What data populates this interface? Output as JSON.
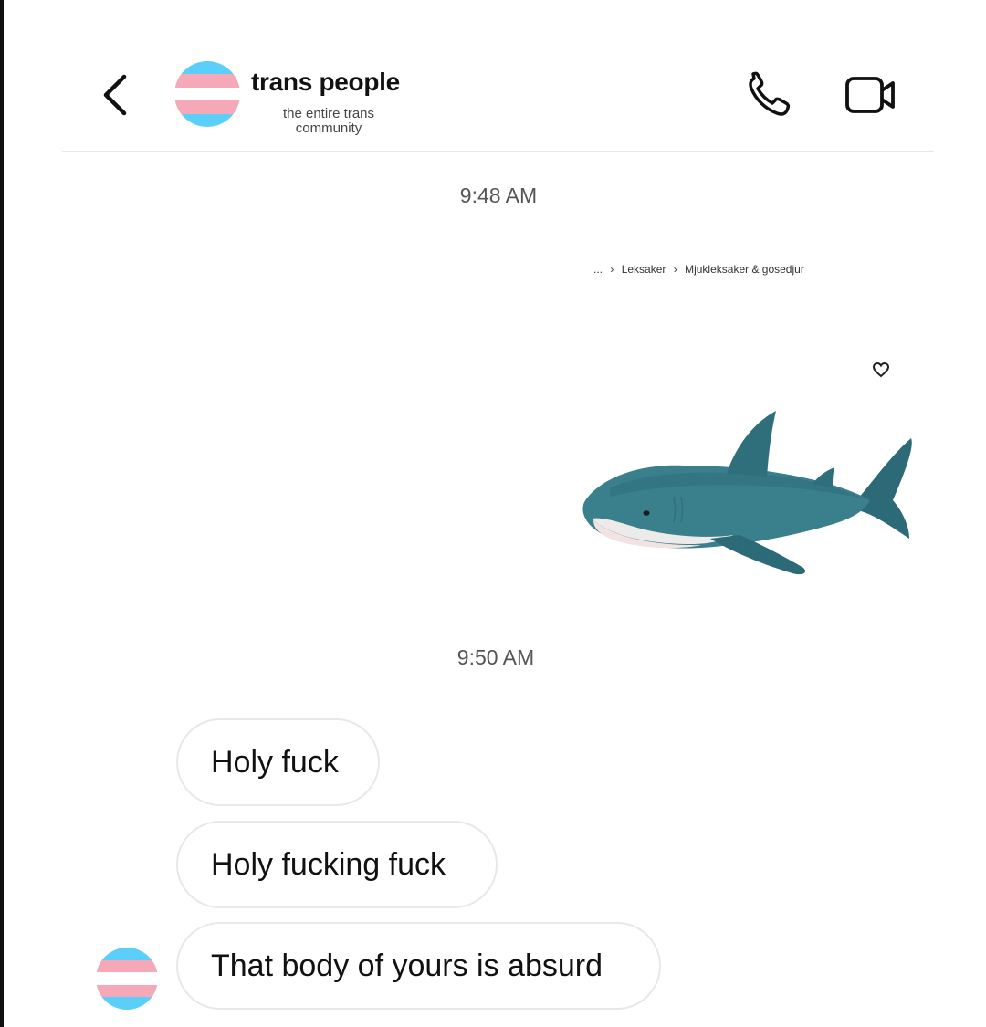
{
  "header": {
    "title": "trans people",
    "subtitle": "the entire trans community",
    "back_icon": "chevron-left-icon",
    "call_icon": "phone-icon",
    "video_icon": "video-camera-icon",
    "avatar_flag_colors": [
      "#5bcefa",
      "#f5a9b8",
      "#ffffff",
      "#f5a9b8",
      "#5bcefa"
    ]
  },
  "conversation": {
    "timestamps": [
      "9:48 AM",
      "9:50 AM"
    ],
    "shared_image": {
      "breadcrumb": [
        "...",
        "›",
        "Leksaker",
        "›",
        "Mjukleksaker & gosedjur"
      ],
      "heart_icon": "heart-outline-icon",
      "content": "shark-plush-icon"
    },
    "messages": [
      {
        "text": "Holy fuck"
      },
      {
        "text": "Holy fucking fuck"
      },
      {
        "text": "That body of yours is absurd"
      }
    ]
  }
}
